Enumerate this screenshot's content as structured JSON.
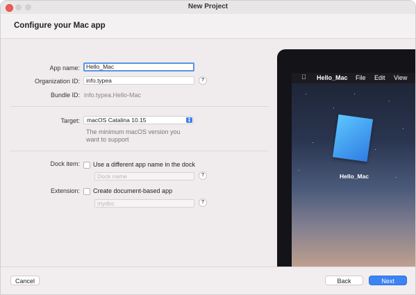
{
  "window": {
    "title": "New Project"
  },
  "header": {
    "title": "Configure your Mac app"
  },
  "form": {
    "app_name": {
      "label": "App name:",
      "value": "Hello_Mac"
    },
    "organization_id": {
      "label": "Organization ID:",
      "value": "info.typea",
      "help": "?"
    },
    "bundle_id": {
      "label": "Bundle ID:",
      "value": "info.typea.Hello-Mac"
    },
    "target": {
      "label": "Target:",
      "selected": "macOS Catalina 10.15",
      "note": "The minimum macOS version you want to support"
    },
    "dock_item": {
      "label": "Dock item:",
      "checkbox_label": "Use a different app name in the dock",
      "checked": false,
      "placeholder": "Dock name",
      "help": "?"
    },
    "extension": {
      "label": "Extension:",
      "checkbox_label": "Create document-based app",
      "checked": false,
      "placeholder": "mydoc",
      "help": "?"
    }
  },
  "preview": {
    "menubar": {
      "apple": "",
      "app": "Hello_Mac",
      "file": "File",
      "edit": "Edit",
      "view": "View"
    },
    "doc_label": "Hello_Mac"
  },
  "footer": {
    "cancel": "Cancel",
    "back": "Back",
    "next": "Next"
  },
  "colors": {
    "accent": "#3c83f3",
    "close": "#ee5d55"
  }
}
